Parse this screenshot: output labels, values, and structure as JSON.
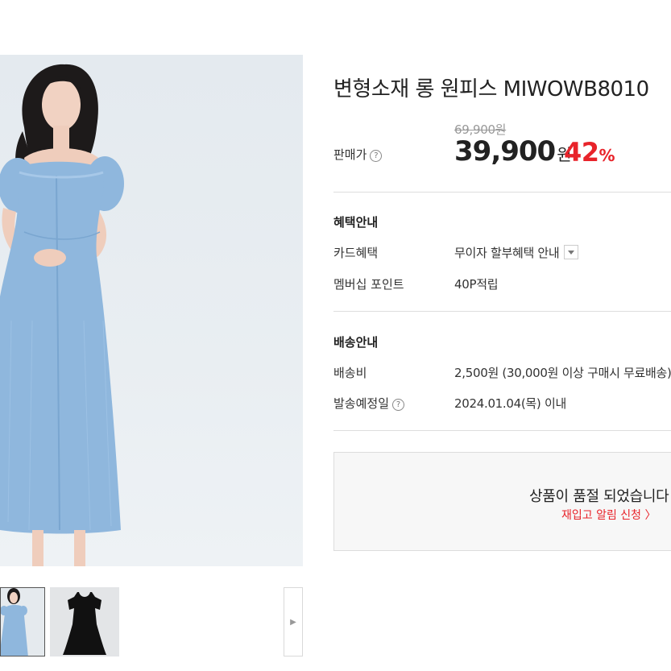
{
  "product": {
    "title": "변형소재 롱 원피스 MIWOWB8010",
    "images": [
      {
        "name": "model-blue-dress"
      },
      {
        "name": "black-dress-flat"
      }
    ]
  },
  "price": {
    "label": "판매가",
    "original": "69,900원",
    "sale": "39,900",
    "currency": "원",
    "discount": "42",
    "discount_unit": "%"
  },
  "benefits": {
    "title": "혜택안내",
    "card_label": "카드혜택",
    "card_value": "무이자 할부혜택 안내",
    "membership_label": "멤버십 포인트",
    "membership_value": "40P적립"
  },
  "shipping": {
    "title": "배송안내",
    "fee_label": "배송비",
    "fee_value": "2,500원 (30,000원 이상 구매시 무료배송)",
    "date_label": "발송예정일",
    "date_value": "2024.01.04(목) 이내"
  },
  "soldout": {
    "message": "상품이 품절 되었습니다",
    "restock_link": "재입고 알림 신청 〉"
  },
  "icons": {
    "help": "?",
    "next": "▶"
  },
  "colors": {
    "accent": "#e8232a",
    "dress": "#8fb7dd"
  }
}
